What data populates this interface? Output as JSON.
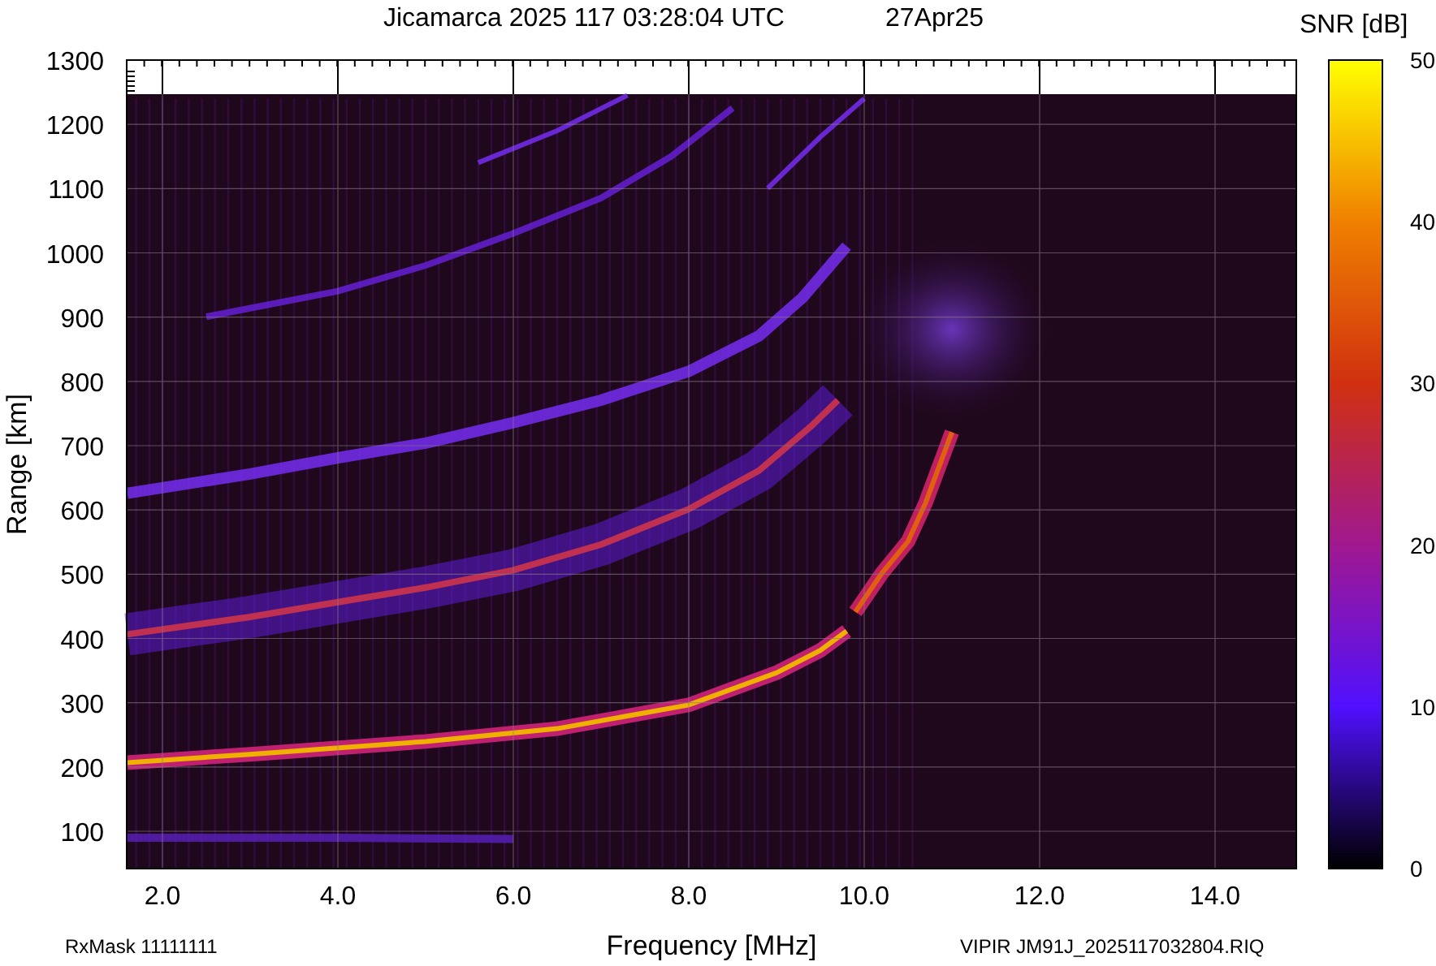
{
  "title": "Jicamarca 2025 117 03:28:04 UTC",
  "date": "27Apr25",
  "plot": {
    "ylabel": "Range [km]",
    "xlabel": "Frequency [MHz]",
    "yticks": [
      "1300",
      "1200",
      "1100",
      "1000",
      "900",
      "800",
      "700",
      "600",
      "500",
      "400",
      "300",
      "200",
      "100"
    ],
    "xticks": [
      "2.0",
      "4.0",
      "6.0",
      "8.0",
      "10.0",
      "12.0",
      "14.0"
    ]
  },
  "colorbar": {
    "title": "SNR [dB]",
    "ticks": [
      "50",
      "40",
      "30",
      "20",
      "10",
      "0"
    ]
  },
  "footer": {
    "left": "RxMask 11111111",
    "right": "VIPIR  JM91J_2025117032804.RIQ"
  }
}
